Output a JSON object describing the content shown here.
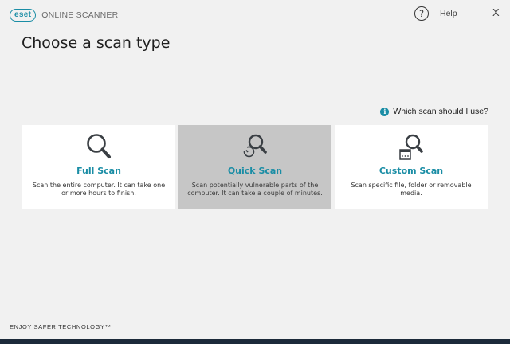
{
  "app": {
    "logo_badge": "eset",
    "logo_text": "ONLINE SCANNER"
  },
  "titlebar": {
    "help_icon": "?",
    "help_label": "Help",
    "minimize_icon": "minimize-icon",
    "close_label": "X"
  },
  "main": {
    "title": "Choose a scan type",
    "help_link": "Which scan should I use?",
    "info_icon": "i"
  },
  "cards": [
    {
      "icon": "magnifier-icon",
      "title": "Full Scan",
      "description": "Scan the entire computer. It can take one or more hours to finish.",
      "selected": false
    },
    {
      "icon": "magnifier-clock-icon",
      "title": "Quick Scan",
      "description": "Scan potentially vulnerable parts of the computer. It can take a couple of minutes.",
      "selected": true
    },
    {
      "icon": "magnifier-window-icon",
      "title": "Custom Scan",
      "description": "Scan specific file, folder or removable media.",
      "selected": false
    }
  ],
  "footer": {
    "tagline": "ENJOY SAFER TECHNOLOGY™"
  },
  "colors": {
    "accent": "#1a8da5",
    "background": "#f1f1f1",
    "selected_card": "#c6c6c6"
  }
}
